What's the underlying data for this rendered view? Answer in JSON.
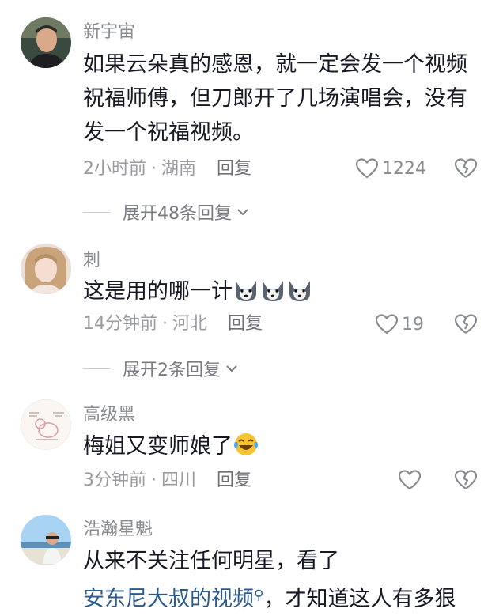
{
  "comments": [
    {
      "username": "新宇宙",
      "text": "如果云朵真的感恩，就一定会发一个视频祝福师傅，但刀郎开了几场演唱会，没有发一个祝福视频。",
      "time": "2小时前",
      "location": "湖南",
      "reply_label": "回复",
      "likes": "1224",
      "expand_label": "展开48条回复"
    },
    {
      "username": "刺",
      "text": "这是用的哪一计",
      "emoji": "shiba-dog-emoji",
      "time": "14分钟前",
      "location": "河北",
      "reply_label": "回复",
      "likes": "19",
      "expand_label": "展开2条回复"
    },
    {
      "username": "高级黑",
      "text": "梅姐又变师娘了",
      "emoji": "laughing-tears-emoji",
      "time": "3分钟前",
      "location": "四川",
      "reply_label": "回复",
      "likes": ""
    },
    {
      "username": "浩瀚星魁",
      "text_line1": "从来不关注任何明星，看了",
      "link_text": "安东尼大叔的视频",
      "text_after_link": "，才知道这人有多狠"
    }
  ],
  "separator": "·",
  "colors": {
    "text": "#161823",
    "meta": "#9a9ba1",
    "link": "#2c5a8c"
  }
}
